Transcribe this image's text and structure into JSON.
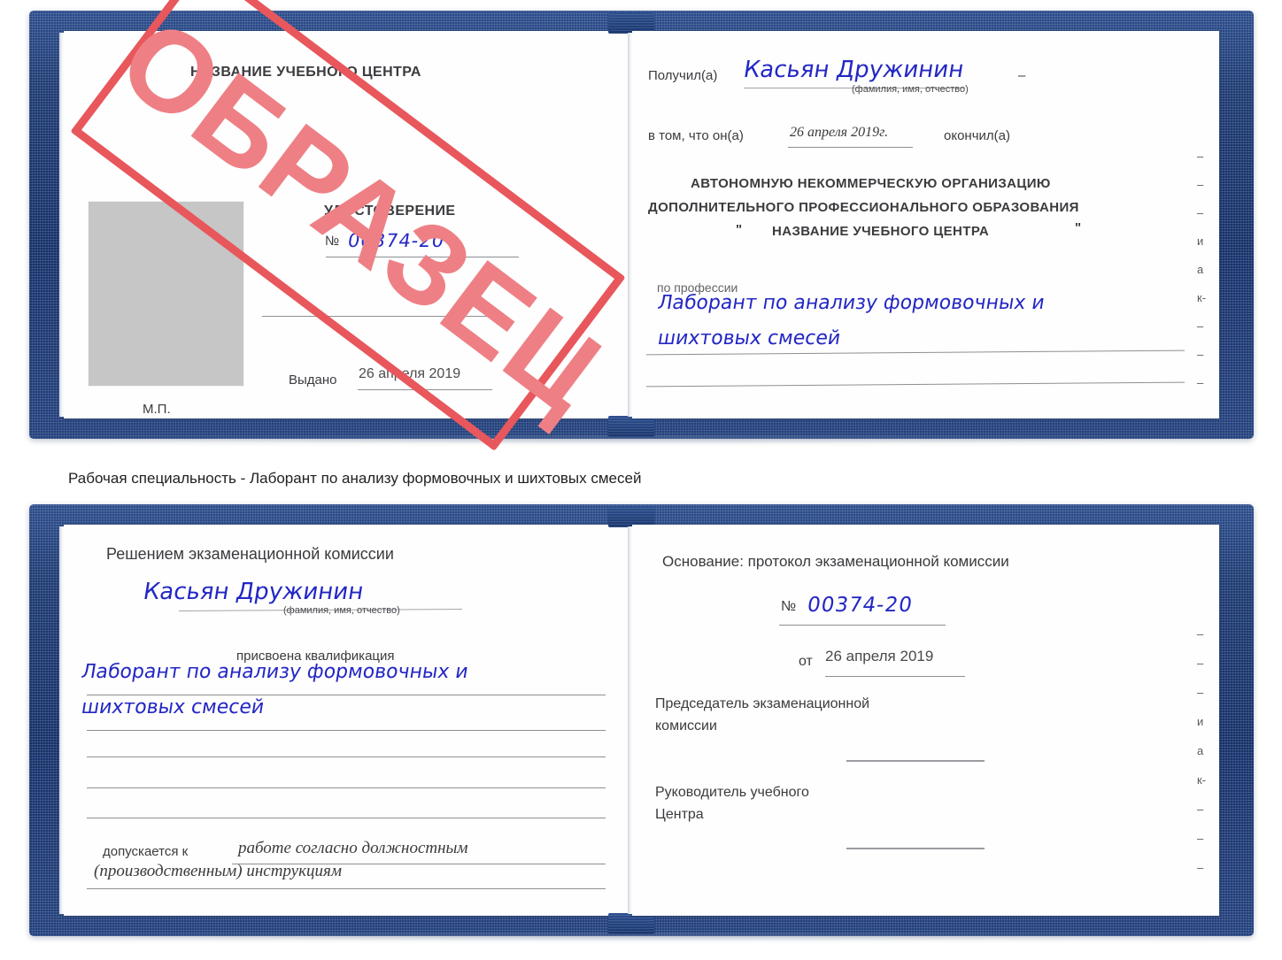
{
  "caption": "Рабочая специальность - Лаборант по анализу формовочных и шихтовых смесей",
  "stamp": {
    "text": "ОБРАЗЕЦ",
    "color": "#e8575b"
  },
  "colors": {
    "cover_blue": "#1d3a72",
    "ink_blue": "#2327c4",
    "stamp_red": "#e8575b",
    "photo_gray": "#c6c6c6"
  },
  "certificate_top": {
    "left_page": {
      "org_title": "НАЗВАНИЕ УЧЕБНОГО ЦЕНТРА",
      "doc_title": "УДОСТОВЕРЕНИЕ",
      "number_symbol": "№",
      "number_value": "00374-20",
      "issued_label": "Выдано",
      "issued_value": "26 апреля 2019",
      "seal_label": "М.П.",
      "photo_placeholder": "photo-box"
    },
    "right_page": {
      "received_label": "Получил(а)",
      "received_value": "Касьян Дружинин",
      "received_hint": "(фамилия, имя, отчество)",
      "dash": "–",
      "in_that_label": "в том, что он(а)",
      "completed_date": "26 апреля 2019г.",
      "finished_label": "окончил(а)",
      "org_line1": "АВТОНОМНУЮ НЕКОММЕРЧЕСКУЮ ОРГАНИЗАЦИЮ",
      "org_line2": "ДОПОЛНИТЕЛЬНОГО ПРОФЕССИОНАЛЬНОГО ОБРАЗОВАНИЯ",
      "org_quote_open": "\"",
      "org_line3": "НАЗВАНИЕ УЧЕБНОГО ЦЕНТРА",
      "org_quote_close": "\"",
      "profession_label": "по профессии",
      "profession_line1": "Лаборант по анализу формовочных и",
      "profession_line2": "шихтовых смесей",
      "edge_glyphs": [
        "–",
        "–",
        "–",
        "и",
        "а",
        "к-",
        "–",
        "–",
        "–",
        "–"
      ]
    }
  },
  "certificate_bottom": {
    "left_page": {
      "decision_title": "Решением экзаменационной комиссии",
      "name_value": "Касьян Дружинин",
      "name_hint": "(фамилия, имя, отчество)",
      "qualification_label": "присвоена квалификация",
      "qualification_line1": "Лаборант по анализу формовочных и",
      "qualification_line2": "шихтовых смесей",
      "admitted_label": "допускается к",
      "admitted_line1": "работе согласно должностным",
      "admitted_line2": "(производственным) инструкциям"
    },
    "right_page": {
      "basis_label": "Основание: протокол экзаменационной комиссии",
      "number_symbol": "№",
      "number_value": "00374-20",
      "from_label": "от",
      "from_value": "26 апреля 2019",
      "chair_line1": "Председатель экзаменационной",
      "chair_line2": "комиссии",
      "head_line1": "Руководитель учебного",
      "head_line2": "Центра",
      "edge_glyphs": [
        "–",
        "–",
        "–",
        "и",
        "а",
        "к-",
        "–",
        "–",
        "–",
        "–"
      ]
    }
  }
}
